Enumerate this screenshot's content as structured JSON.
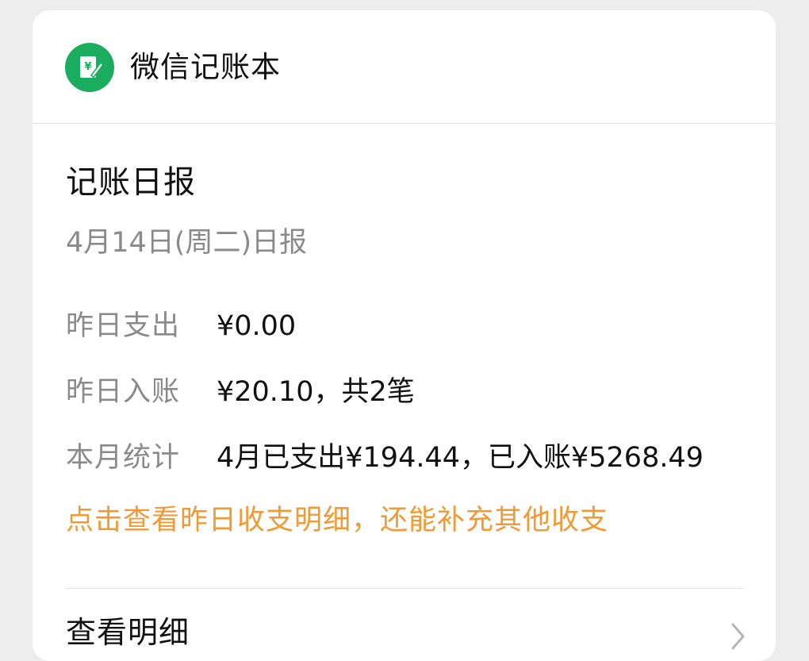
{
  "header": {
    "app_name": "微信记账本",
    "icon": "ledger-yen-icon",
    "brand_color": "#1aad5f"
  },
  "report": {
    "title": "记账日报",
    "date_line": "4月14日(周二)日报",
    "rows": [
      {
        "label": "昨日支出",
        "value": "¥0.00"
      },
      {
        "label": "昨日入账",
        "value": "¥20.10，共2笔"
      },
      {
        "label": "本月统计",
        "value": "4月已支出¥194.44，已入账¥5268.49"
      }
    ],
    "hint": "点击查看昨日收支明细，还能补充其他收支",
    "hint_color": "#ef9a35"
  },
  "footer": {
    "details_label": "查看明细",
    "chevron_icon": "chevron-right-icon"
  }
}
